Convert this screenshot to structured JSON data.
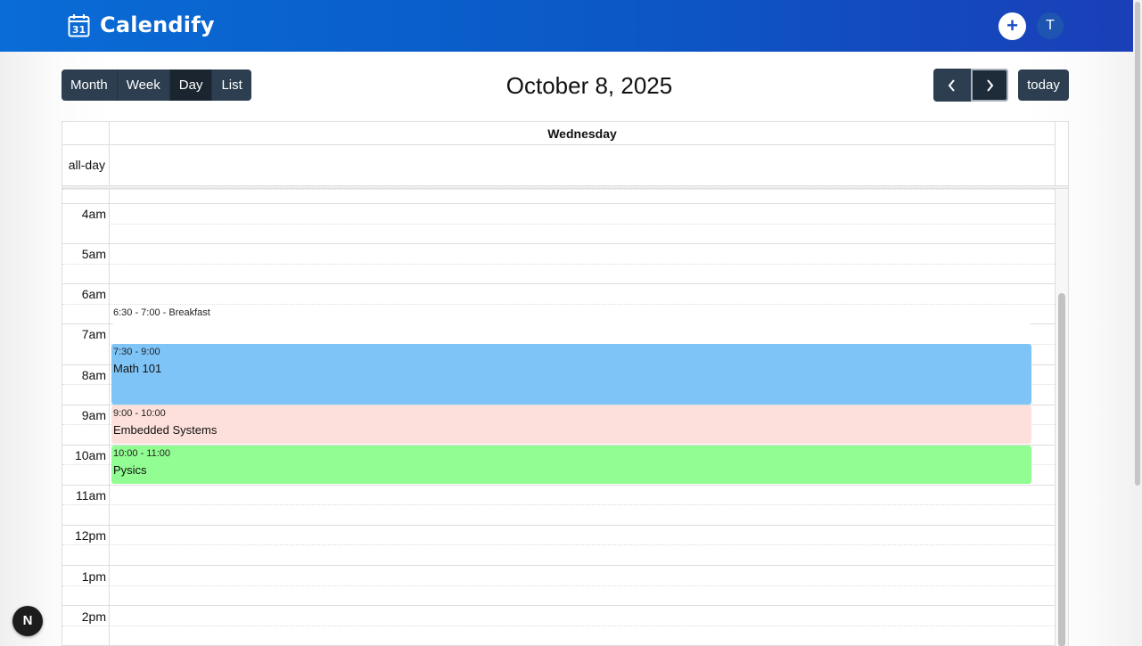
{
  "app": {
    "name": "Calendify",
    "logo_icon": "calendar-31-icon",
    "logo_day": "31",
    "add_icon_glyph": "+",
    "avatar_initial": "T"
  },
  "toolbar": {
    "views": [
      {
        "label": "Month",
        "active": false
      },
      {
        "label": "Week",
        "active": false
      },
      {
        "label": "Day",
        "active": true
      },
      {
        "label": "List",
        "active": false
      }
    ],
    "title": "October 8, 2025",
    "prev_icon": "chevron-left-icon",
    "next_icon": "chevron-right-icon",
    "today_label": "today"
  },
  "calendar": {
    "day_header": "Wednesday",
    "allday_label": "all-day",
    "time_labels": [
      "4am",
      "5am",
      "6am",
      "7am",
      "8am",
      "9am",
      "10am",
      "11am",
      "12pm",
      "1pm",
      "2pm"
    ],
    "events": [
      {
        "time": "6:30 - 7:00",
        "title": "Breakfast",
        "inline_text": "6:30 - 7:00 - Breakfast",
        "color": "#ffffff"
      },
      {
        "time": "7:30 - 9:00",
        "title": "Math 101",
        "color": "#7fc4f7"
      },
      {
        "time": "9:00 - 10:00",
        "title": "Embedded Systems",
        "color": "#fde0db"
      },
      {
        "time": "10:00 - 11:00",
        "title": "Pysics",
        "color": "#92fd92"
      }
    ]
  },
  "floating_badge": "N",
  "colors": {
    "header_gradient_start": "#0a6cd6",
    "header_gradient_end": "#1a3fb8",
    "button_dark": "#2c3e50"
  }
}
